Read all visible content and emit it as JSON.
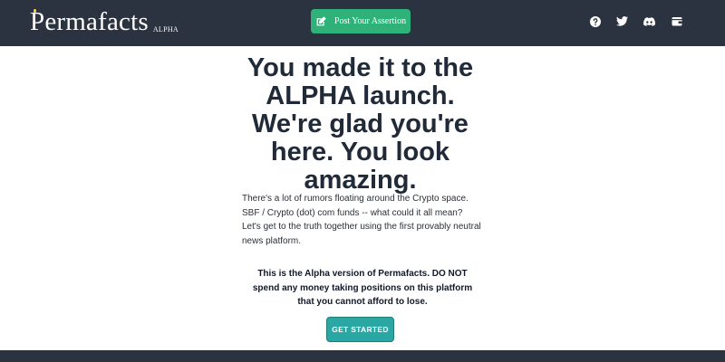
{
  "header": {
    "brand_name": "Permafacts",
    "brand_tag": "ALPHA",
    "post_button_label": "Post Your Assertion",
    "icons": [
      "help-icon",
      "twitter-icon",
      "discord-icon",
      "wallet-icon"
    ]
  },
  "hero": {
    "title": "You made it to the ALPHA launch. We're glad you're here. You look amazing.",
    "description": "There's a lot of rumors floating around the Crypto space. SBF / Crypto (dot) com funds -- what could it all mean? Let's get to the truth together using the first provably neutral news platform.",
    "warning": "This is the Alpha version of Permafacts. DO NOT spend any money taking positions on this platform that you cannot afford to lose.",
    "cta_label": "GET STARTED"
  },
  "colors": {
    "header_bg": "#2b3240",
    "post_button": "#2fb27a",
    "cta_button": "#2aa7a2",
    "title_text": "#202a38"
  }
}
